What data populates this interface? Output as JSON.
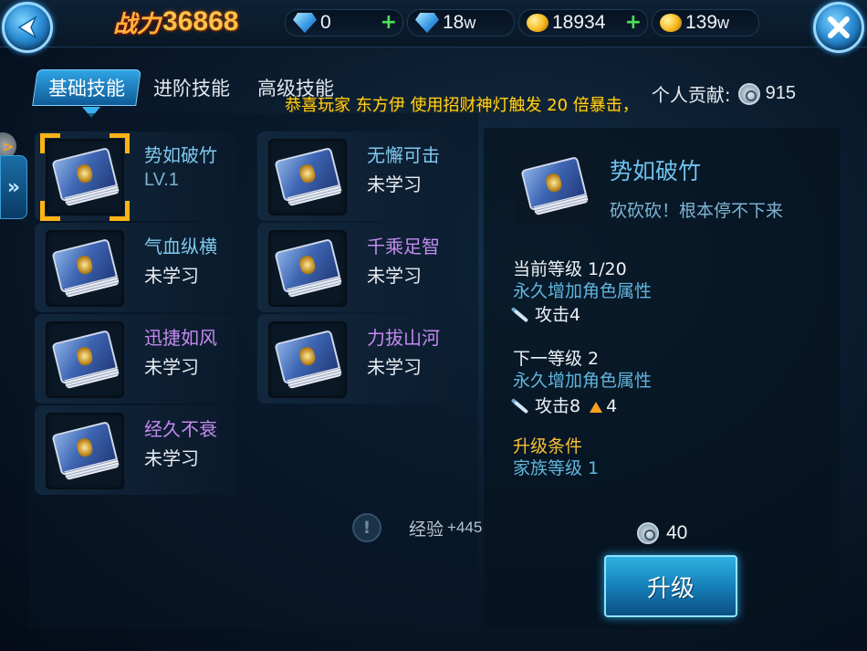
{
  "topbar": {
    "power_label": "战力",
    "power_value": "36868",
    "resources": [
      {
        "icon": "diamond-icon",
        "value": "0",
        "has_plus": true
      },
      {
        "icon": "bound-diamond-icon",
        "value": "18",
        "suffix": "w",
        "has_plus": false
      },
      {
        "icon": "gold-coin-icon",
        "value": "18934",
        "has_plus": true
      },
      {
        "icon": "bound-gold-icon",
        "value": "139",
        "suffix": "w",
        "has_plus": false
      }
    ],
    "plus_symbol": "+"
  },
  "tabs": [
    {
      "label": "基础技能",
      "active": true
    },
    {
      "label": "进阶技能",
      "active": false
    },
    {
      "label": "高级技能",
      "active": false
    }
  ],
  "contribution": {
    "label": "个人贡献:",
    "value": "915"
  },
  "broadcast": "恭喜玩家 东方伊 使用招财神灯触发 20 倍暴击，",
  "side": {
    "knob_glyph": ">",
    "tab_glyph": "»"
  },
  "skills": [
    {
      "name": "势如破竹",
      "status": "LV.1",
      "learned": true,
      "selected": true,
      "name_color": "blue"
    },
    {
      "name": "无懈可击",
      "status": "未学习",
      "learned": false,
      "selected": false,
      "name_color": "blue"
    },
    {
      "name": "气血纵横",
      "status": "未学习",
      "learned": false,
      "selected": false,
      "name_color": "blue"
    },
    {
      "name": "千乘足智",
      "status": "未学习",
      "learned": false,
      "selected": false,
      "name_color": "purple"
    },
    {
      "name": "迅捷如风",
      "status": "未学习",
      "learned": false,
      "selected": false,
      "name_color": "purple"
    },
    {
      "name": "力拔山河",
      "status": "未学习",
      "learned": false,
      "selected": false,
      "name_color": "purple"
    },
    {
      "name": "经久不衰",
      "status": "未学习",
      "learned": false,
      "selected": false,
      "name_color": "purple"
    }
  ],
  "exp": {
    "label": "经验",
    "value": "+445",
    "info_glyph": "!"
  },
  "detail": {
    "title": "势如破竹",
    "description": "砍砍砍！根本停不下来",
    "current_level_label": "当前等级 1/20",
    "current_effect": "永久增加角色属性",
    "current_stat": "攻击4",
    "next_level_label": "下一等级 2",
    "next_effect": "永久增加角色属性",
    "next_stat": "攻击8",
    "next_increase": "4",
    "requirement_title": "升级条件",
    "requirement_text": "家族等级 1",
    "cost": "40",
    "upgrade_label": "升级"
  },
  "colors": {
    "accent": "#2fa4e6",
    "power_gold": "#ffc24a",
    "broadcast_yellow": "#ffd21f",
    "skill_blue": "#7fc8ee",
    "skill_purple": "#c58af0",
    "requirement_gold": "#f7c135"
  }
}
